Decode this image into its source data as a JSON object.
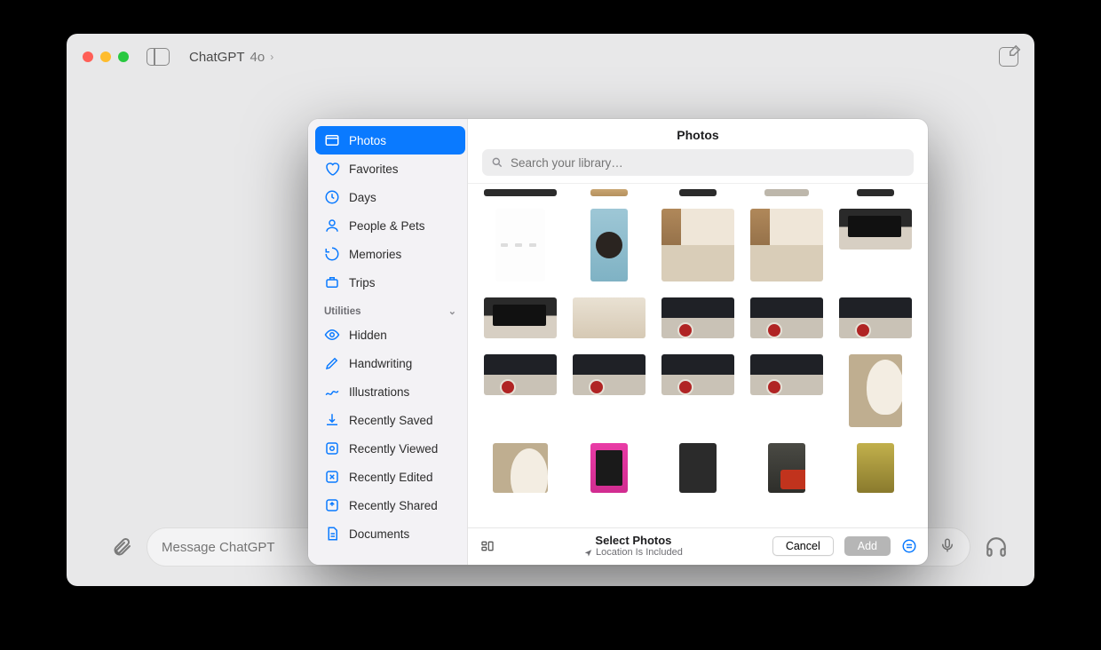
{
  "app": {
    "title": "ChatGPT",
    "model": "4o"
  },
  "composer": {
    "placeholder": "Message ChatGPT"
  },
  "picker": {
    "title": "Photos",
    "search_placeholder": "Search your library…",
    "footer": {
      "title": "Select Photos",
      "subtitle": "Location Is Included",
      "cancel": "Cancel",
      "add": "Add"
    },
    "sidebar": {
      "items": [
        {
          "icon": "photos",
          "label": "Photos",
          "selected": true
        },
        {
          "icon": "heart",
          "label": "Favorites"
        },
        {
          "icon": "clock",
          "label": "Days"
        },
        {
          "icon": "person",
          "label": "People & Pets"
        },
        {
          "icon": "memories",
          "label": "Memories"
        },
        {
          "icon": "trips",
          "label": "Trips"
        }
      ],
      "section": "Utilities",
      "util_items": [
        {
          "icon": "eye",
          "label": "Hidden"
        },
        {
          "icon": "pencil",
          "label": "Handwriting"
        },
        {
          "icon": "scribble",
          "label": "Illustrations"
        },
        {
          "icon": "download",
          "label": "Recently Saved"
        },
        {
          "icon": "viewed",
          "label": "Recently Viewed"
        },
        {
          "icon": "edited",
          "label": "Recently Edited"
        },
        {
          "icon": "shared",
          "label": "Recently Shared"
        },
        {
          "icon": "doc",
          "label": "Documents"
        }
      ]
    }
  }
}
